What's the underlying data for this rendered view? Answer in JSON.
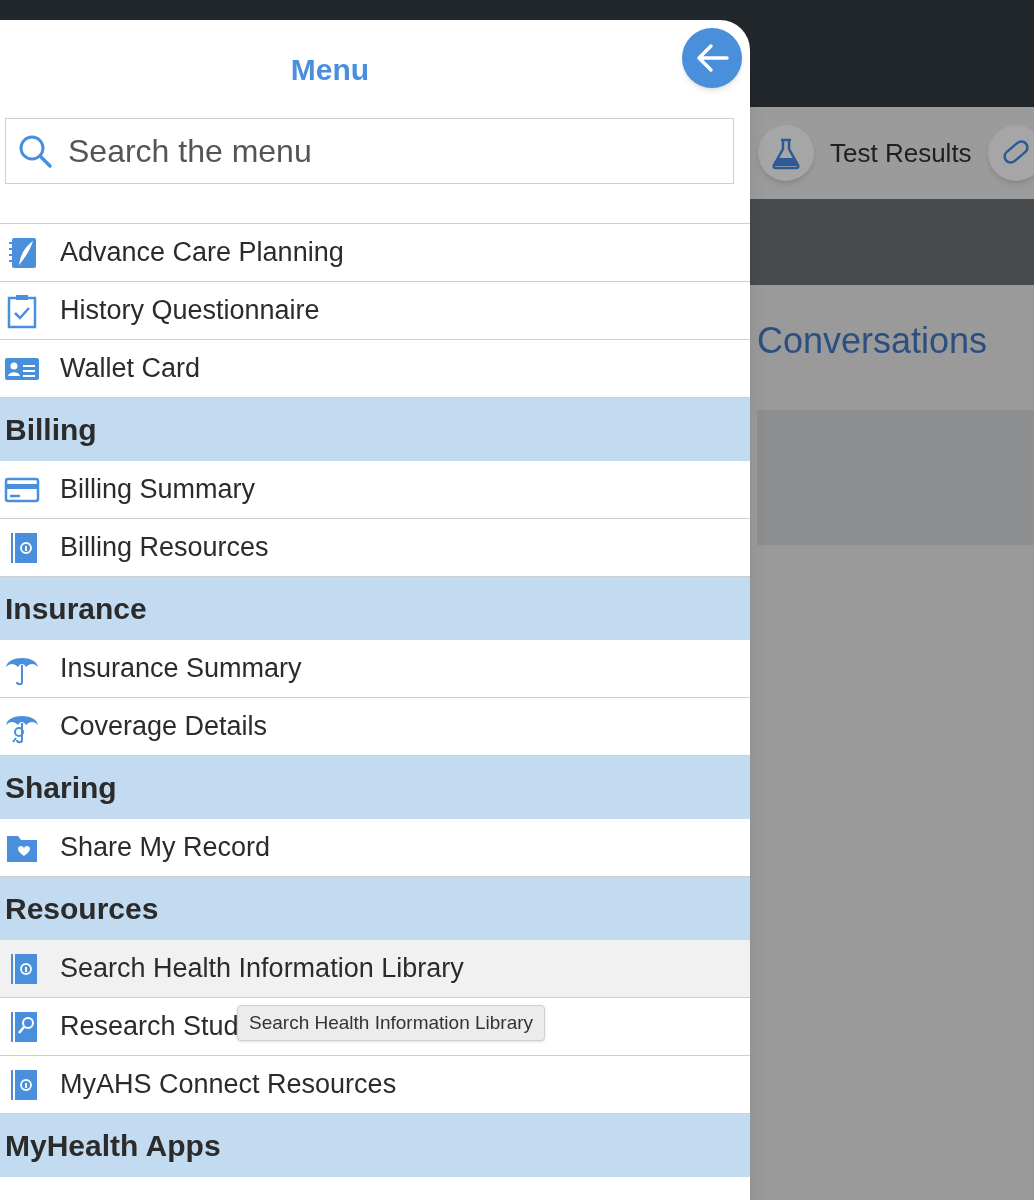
{
  "background": {
    "tabs": [
      {
        "label": "Test Results",
        "kind": "flask"
      },
      {
        "kind": "pill"
      }
    ],
    "heading": "Conversations"
  },
  "menu": {
    "title": "Menu",
    "search": {
      "placeholder": "Search the menu"
    },
    "sections": [
      {
        "items": [
          {
            "label": "Advance Care Planning",
            "kind": "notebook",
            "hovered": false
          },
          {
            "label": "History Questionnaire",
            "kind": "clipboard",
            "hovered": false
          },
          {
            "label": "Wallet Card",
            "kind": "card",
            "hovered": false
          }
        ]
      },
      {
        "heading": "Billing",
        "items": [
          {
            "label": "Billing Summary",
            "kind": "payment",
            "hovered": false
          },
          {
            "label": "Billing Resources",
            "kind": "info",
            "hovered": false
          }
        ]
      },
      {
        "heading": "Insurance",
        "items": [
          {
            "label": "Insurance Summary",
            "kind": "umbrella",
            "hovered": false
          },
          {
            "label": "Coverage Details",
            "kind": "coverage",
            "hovered": false
          }
        ]
      },
      {
        "heading": "Sharing",
        "items": [
          {
            "label": "Share My Record",
            "kind": "folder",
            "hovered": false
          }
        ]
      },
      {
        "heading": "Resources",
        "items": [
          {
            "label": "Search Health Information Library",
            "kind": "info",
            "hovered": true
          },
          {
            "label": "Research Stud",
            "kind": "research",
            "hovered": false
          },
          {
            "label": "MyAHS Connect Resources",
            "kind": "info",
            "hovered": false
          }
        ]
      },
      {
        "heading": "MyHealth Apps"
      }
    ]
  },
  "tooltip": "Search Health Information Library"
}
